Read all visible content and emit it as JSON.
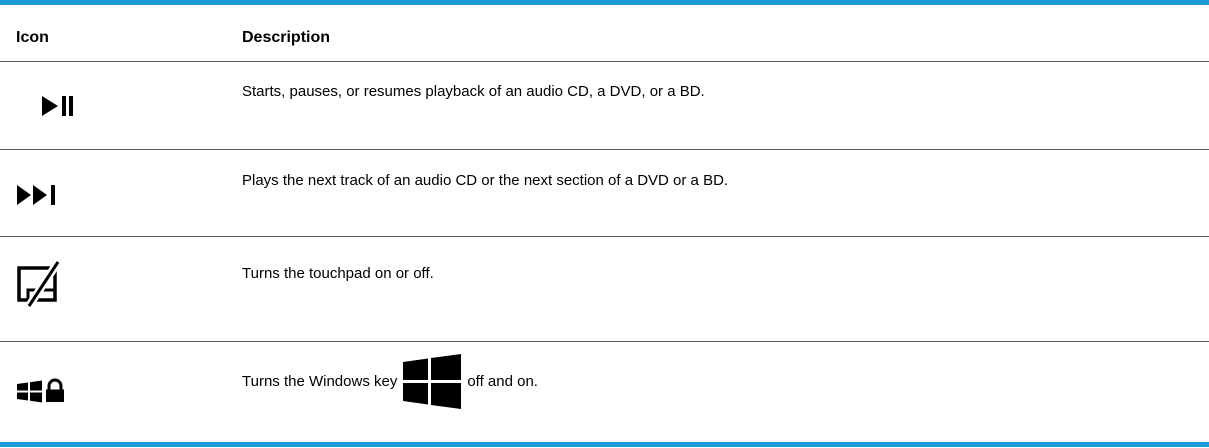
{
  "colors": {
    "accent": "#1a9ad6",
    "divider": "#5a5a5a",
    "text": "#000000"
  },
  "table": {
    "headers": {
      "icon": "Icon",
      "description": "Description"
    },
    "rows": [
      {
        "icon": "play-pause-icon",
        "description": "Starts, pauses, or resumes playback of an audio CD, a DVD, or a BD."
      },
      {
        "icon": "next-track-icon",
        "description": "Plays the next track of an audio CD or the next section of a DVD or a BD."
      },
      {
        "icon": "touchpad-toggle-icon",
        "description": "Turns the touchpad on or off."
      },
      {
        "icon": "windows-lock-icon",
        "description_before": "Turns the Windows key",
        "inline_icon": "windows-logo-icon",
        "description_after": "off and on."
      }
    ]
  }
}
